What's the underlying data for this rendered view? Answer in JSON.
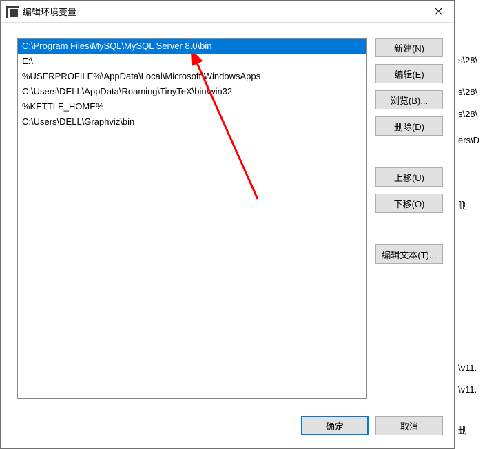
{
  "dialog": {
    "title": "编辑环境变量"
  },
  "list": {
    "items": [
      "C:\\Program Files\\MySQL\\MySQL Server 8.0\\bin",
      "E:\\",
      "%USERPROFILE%\\AppData\\Local\\Microsoft\\WindowsApps",
      "C:\\Users\\DELL\\AppData\\Roaming\\TinyTeX\\bin\\win32",
      "%KETTLE_HOME%",
      "C:\\Users\\DELL\\Graphviz\\bin"
    ],
    "selected_index": 0
  },
  "buttons": {
    "new": "新建(N)",
    "edit": "编辑(E)",
    "browse": "浏览(B)...",
    "delete": "删除(D)",
    "moveup": "上移(U)",
    "movedown": "下移(O)",
    "edittext": "编辑文本(T)...",
    "ok": "确定",
    "cancel": "取消"
  },
  "backdrop_hints": {
    "l1": "s\\28\\",
    "l2": "s\\28\\",
    "l3": "s\\28\\",
    "l4": "ers\\D",
    "l5": "删",
    "l6": "\\v11.",
    "l7": "\\v11.",
    "l8": "删"
  }
}
